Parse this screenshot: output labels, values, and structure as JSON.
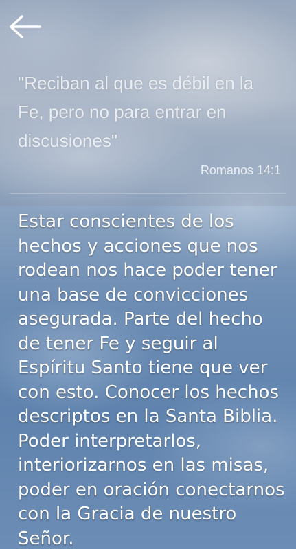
{
  "header": {
    "back_icon": "arrow-left-icon"
  },
  "verse": {
    "quote": "\"Reciban al que es débil en la Fe, pero no para entrar en discusiones\"",
    "reference": "Romanos 14:1"
  },
  "reflection": {
    "text": "Estar conscientes de los hechos y acciones que nos rodean nos hace poder tener una base de convic­ciones asegurada. Parte del hecho de tener Fe y seguir al Espíritu Santo tiene que ver con esto. Conocer los hechos descriptos en la Santa Biblia. Poder inter­pretarlos, interiorizarnos en las misas, poder en oración conectarnos con la Gracia de nuestro Señor."
  },
  "colors": {
    "text": "#ffffff",
    "quote_text": "#e9edf2"
  }
}
